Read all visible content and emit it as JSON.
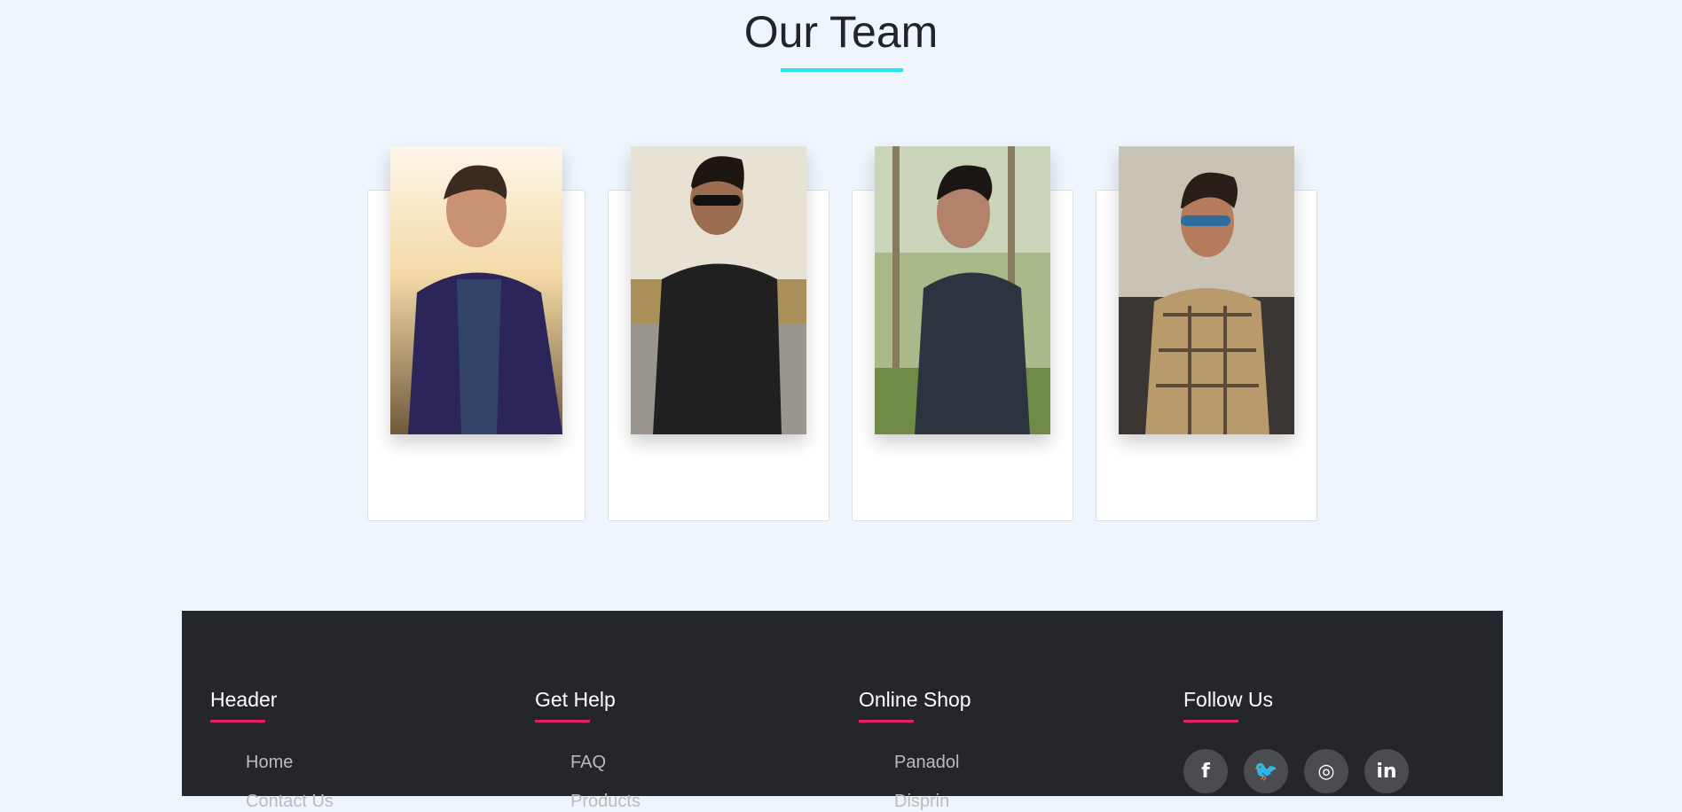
{
  "section": {
    "title": "Our Team"
  },
  "team": [
    {
      "photo": "team-member-photo-1"
    },
    {
      "photo": "team-member-photo-2"
    },
    {
      "photo": "team-member-photo-3"
    },
    {
      "photo": "team-member-photo-4"
    }
  ],
  "footer": {
    "columns": [
      {
        "heading": "Header",
        "links": [
          "Home",
          "Contact Us"
        ]
      },
      {
        "heading": "Get Help",
        "links": [
          "FAQ",
          "Products"
        ]
      },
      {
        "heading": "Online Shop",
        "links": [
          "Panadol",
          "Disprin"
        ]
      },
      {
        "heading": "Follow Us"
      }
    ],
    "socials": [
      {
        "icon": "facebook-icon",
        "glyph": "f"
      },
      {
        "icon": "twitter-icon",
        "glyph": "🐦"
      },
      {
        "icon": "instagram-icon",
        "glyph": "◎"
      },
      {
        "icon": "linkedin-icon",
        "glyph": "in"
      }
    ]
  },
  "colors": {
    "background": "#eff5fd",
    "title_underline": "#1de9f2",
    "footer_bg": "#24262b",
    "footer_accent": "#e91e63"
  }
}
